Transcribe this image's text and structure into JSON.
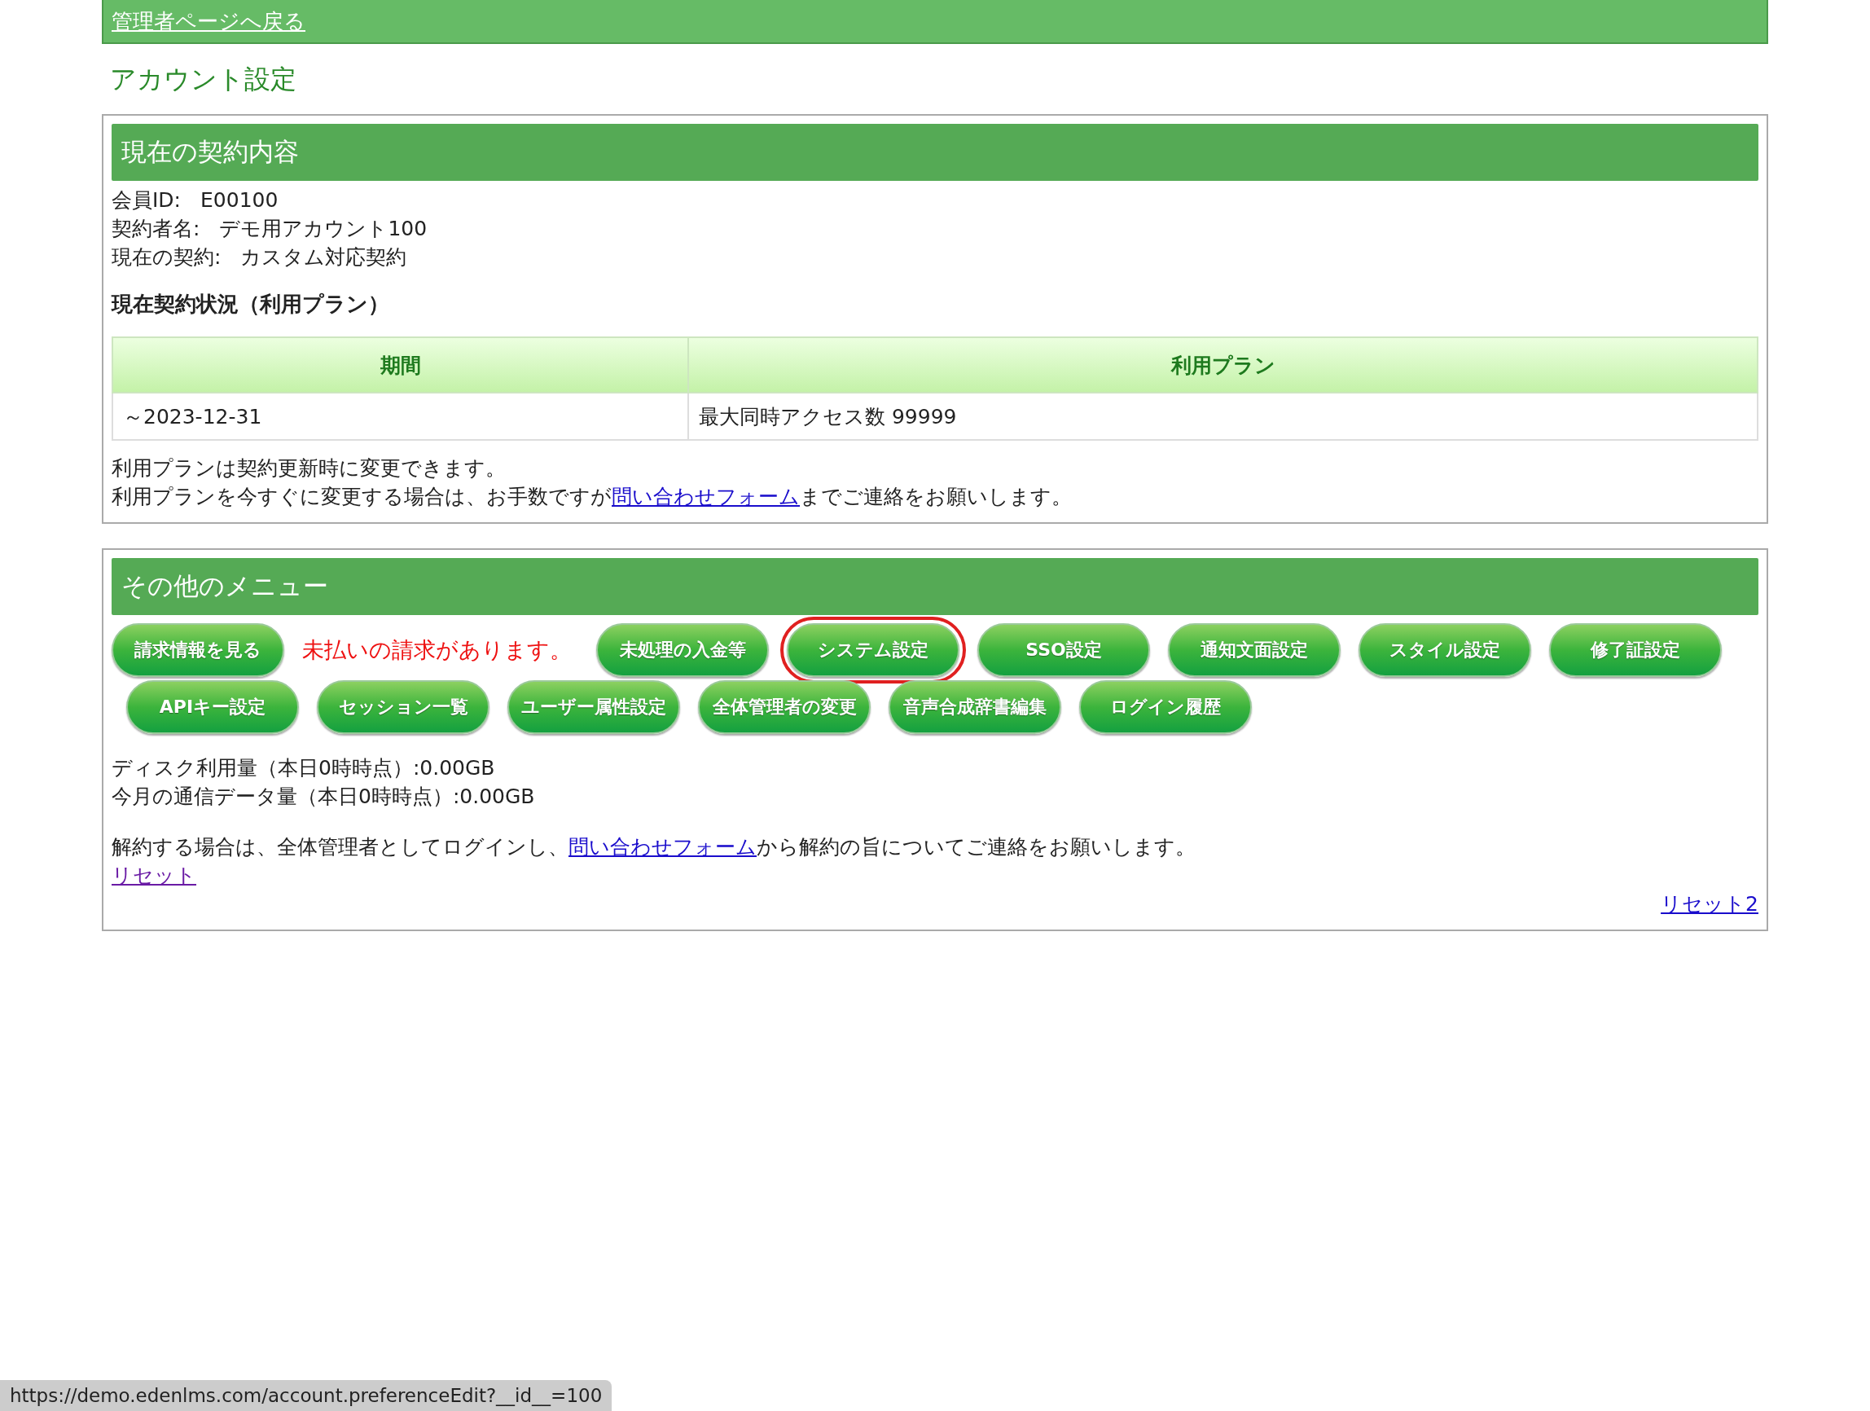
{
  "top_bar": {
    "back_link": "管理者ページへ戻る"
  },
  "page_title": "アカウント設定",
  "contract": {
    "heading": "現在の契約内容",
    "fields": [
      {
        "label": "会員ID:",
        "value": "E00100"
      },
      {
        "label": "契約者名:",
        "value": "デモ用アカウント100"
      },
      {
        "label": "現在の契約:",
        "value": "カスタム対応契約"
      }
    ],
    "status_heading": "現在契約状況（利用プラン）",
    "table": {
      "columns": [
        "期間",
        "利用プラン"
      ],
      "rows": [
        [
          "～2023-12-31",
          "最大同時アクセス数 99999"
        ]
      ]
    },
    "note": "利用プランは契約更新時に変更できます。",
    "contact": {
      "before": "利用プランを今すぐに変更する場合は、お手数ですが",
      "link": "問い合わせフォーム",
      "after": "までご連絡をお願いします。"
    }
  },
  "other_menu": {
    "heading": "その他のメニュー",
    "items": [
      {
        "kind": "button",
        "label": "請求情報を見る",
        "highlighted": false
      },
      {
        "kind": "notice",
        "label": "未払いの請求があります。"
      },
      {
        "kind": "button",
        "label": "未処理の入金等",
        "highlighted": false
      },
      {
        "kind": "button",
        "label": "システム設定",
        "highlighted": true
      },
      {
        "kind": "button",
        "label": "SSO設定",
        "highlighted": false
      },
      {
        "kind": "button",
        "label": "通知文面設定",
        "highlighted": false
      },
      {
        "kind": "button",
        "label": "スタイル設定",
        "highlighted": false
      },
      {
        "kind": "button",
        "label": "修了証設定",
        "highlighted": false
      },
      {
        "kind": "button",
        "label": "APIキー設定",
        "highlighted": false
      },
      {
        "kind": "button",
        "label": "セッション一覧",
        "highlighted": false
      },
      {
        "kind": "button",
        "label": "ユーザー属性設定",
        "highlighted": false
      },
      {
        "kind": "button",
        "label": "全体管理者の変更",
        "highlighted": false
      },
      {
        "kind": "button",
        "label": "音声合成辞書編集",
        "highlighted": false
      },
      {
        "kind": "button",
        "label": "ログイン履歴",
        "highlighted": false
      }
    ],
    "usage": [
      "ディスク利用量（本日0時時点）:0.00GB",
      "今月の通信データ量（本日0時時点）:0.00GB"
    ],
    "cancel": {
      "before": "解約する場合は、全体管理者としてログインし、",
      "link": "問い合わせフォーム",
      "after": "から解約の旨についてご連絡をお願いします。"
    },
    "reset_links": [
      {
        "label": "リセット",
        "visited": true
      },
      {
        "label": "リセット2",
        "visited": false
      }
    ]
  },
  "status_bar": {
    "url": "https://demo.edenlms.com/account.preferenceEdit?__id__=100"
  }
}
